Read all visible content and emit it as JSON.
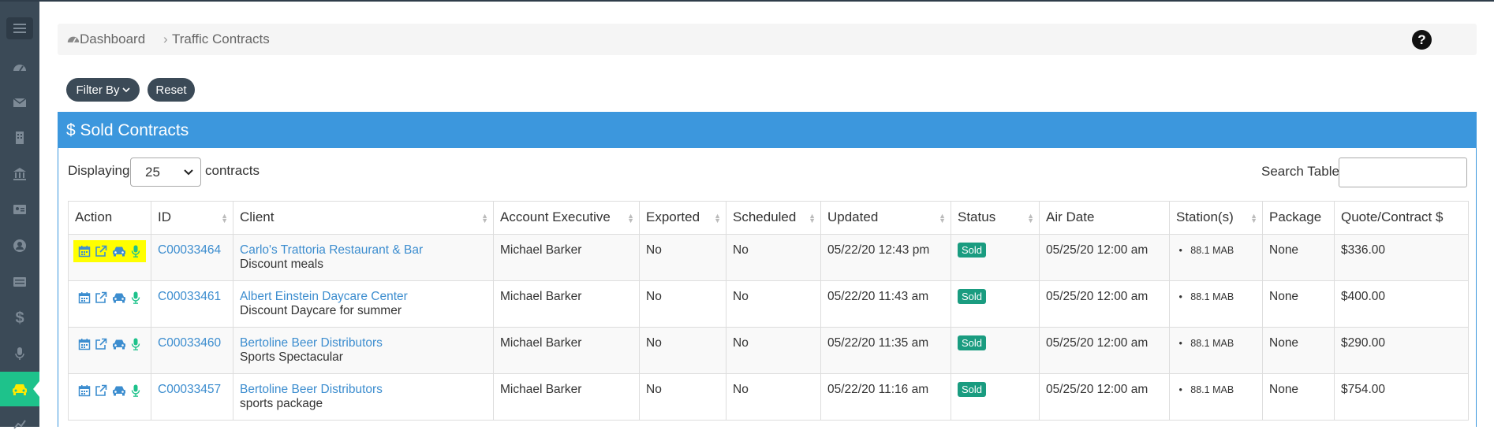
{
  "breadcrumb": {
    "home": "Dashboard",
    "sep": "›",
    "current": "Traffic Contracts"
  },
  "help": "?",
  "toolbar": {
    "filter_label": "Filter By",
    "reset_label": "Reset"
  },
  "panel": {
    "title": "$ Sold Contracts"
  },
  "display": {
    "prefix": "Displaying",
    "value": "25",
    "suffix": "contracts"
  },
  "search": {
    "label": "Search Table",
    "placeholder": ""
  },
  "columns": [
    "Action",
    "ID",
    "Client",
    "Account Executive",
    "Exported",
    "Scheduled",
    "Updated",
    "Status",
    "Air Date",
    "Station(s)",
    "Package",
    "Quote/Contract $"
  ],
  "rows": [
    {
      "id": "C00033464",
      "client": "Carlo's Trattoria Restaurant & Bar",
      "desc": "Discount meals",
      "ae": "Michael Barker",
      "exported": "No",
      "scheduled": "No",
      "updated": "05/22/20 12:43 pm",
      "status": "Sold",
      "air": "05/25/20 12:00 am",
      "station": "88.1 MAB",
      "package": "None",
      "amount": "$336.00"
    },
    {
      "id": "C00033461",
      "client": "Albert Einstein Daycare Center",
      "desc": "Discount Daycare for summer",
      "ae": "Michael Barker",
      "exported": "No",
      "scheduled": "No",
      "updated": "05/22/20 11:43 am",
      "status": "Sold",
      "air": "05/25/20 12:00 am",
      "station": "88.1 MAB",
      "package": "None",
      "amount": "$400.00"
    },
    {
      "id": "C00033460",
      "client": "Bertoline Beer Distributors",
      "desc": "Sports Spectacular",
      "ae": "Michael Barker",
      "exported": "No",
      "scheduled": "No",
      "updated": "05/22/20 11:35 am",
      "status": "Sold",
      "air": "05/25/20 12:00 am",
      "station": "88.1 MAB",
      "package": "None",
      "amount": "$290.00"
    },
    {
      "id": "C00033457",
      "client": "Bertoline Beer Distributors",
      "desc": "sports package",
      "ae": "Michael Barker",
      "exported": "No",
      "scheduled": "No",
      "updated": "05/22/20 11:16 am",
      "status": "Sold",
      "air": "05/25/20 12:00 am",
      "station": "88.1 MAB",
      "package": "None",
      "amount": "$754.00"
    }
  ],
  "colors": {
    "sidebar": "#3b4a57",
    "active": "#1ec28b",
    "panel": "#3c97dd",
    "badge": "#1a9c80",
    "link": "#3c8dcf",
    "highlight": "#ffff00"
  },
  "icons": [
    "menu-icon",
    "dashboard-icon",
    "envelope-icon",
    "building-icon",
    "bank-icon",
    "id-card-icon",
    "user-icon",
    "list-icon",
    "dollar-icon",
    "microphone-icon",
    "car-icon",
    "chart-icon"
  ]
}
